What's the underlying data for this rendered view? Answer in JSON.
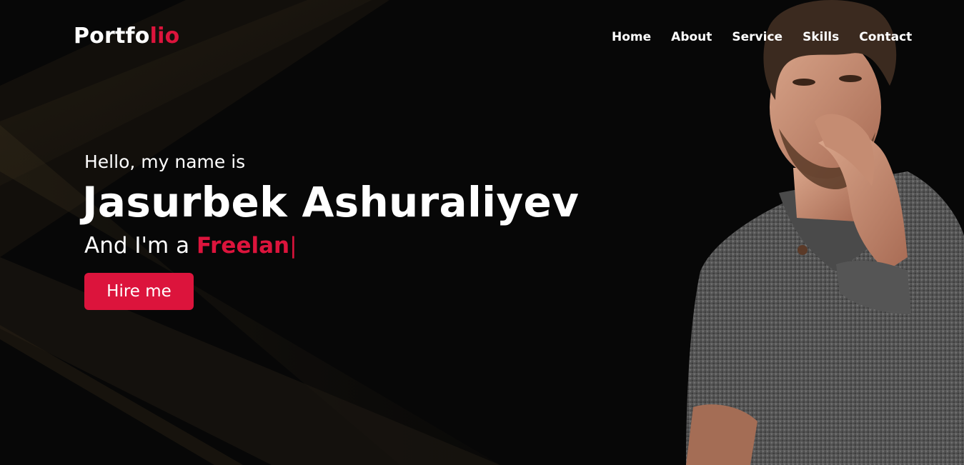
{
  "brand": {
    "logo_main": "Portfo",
    "logo_accent": "lio"
  },
  "nav": {
    "items": [
      {
        "label": "Home"
      },
      {
        "label": "About"
      },
      {
        "label": "Service"
      },
      {
        "label": "Skills"
      },
      {
        "label": "Contact"
      }
    ]
  },
  "hero": {
    "greeting": "Hello, my name is",
    "name": "Jasurbek Ashuraliyev",
    "tagline_prefix": "And I'm a ",
    "typed_role": "Freelan",
    "cursor": "|",
    "cta_label": "Hire me"
  },
  "colors": {
    "accent": "#dc143c",
    "background": "#070707",
    "text": "#ffffff"
  },
  "icons": {
    "portrait": "man-portrait-photo"
  }
}
